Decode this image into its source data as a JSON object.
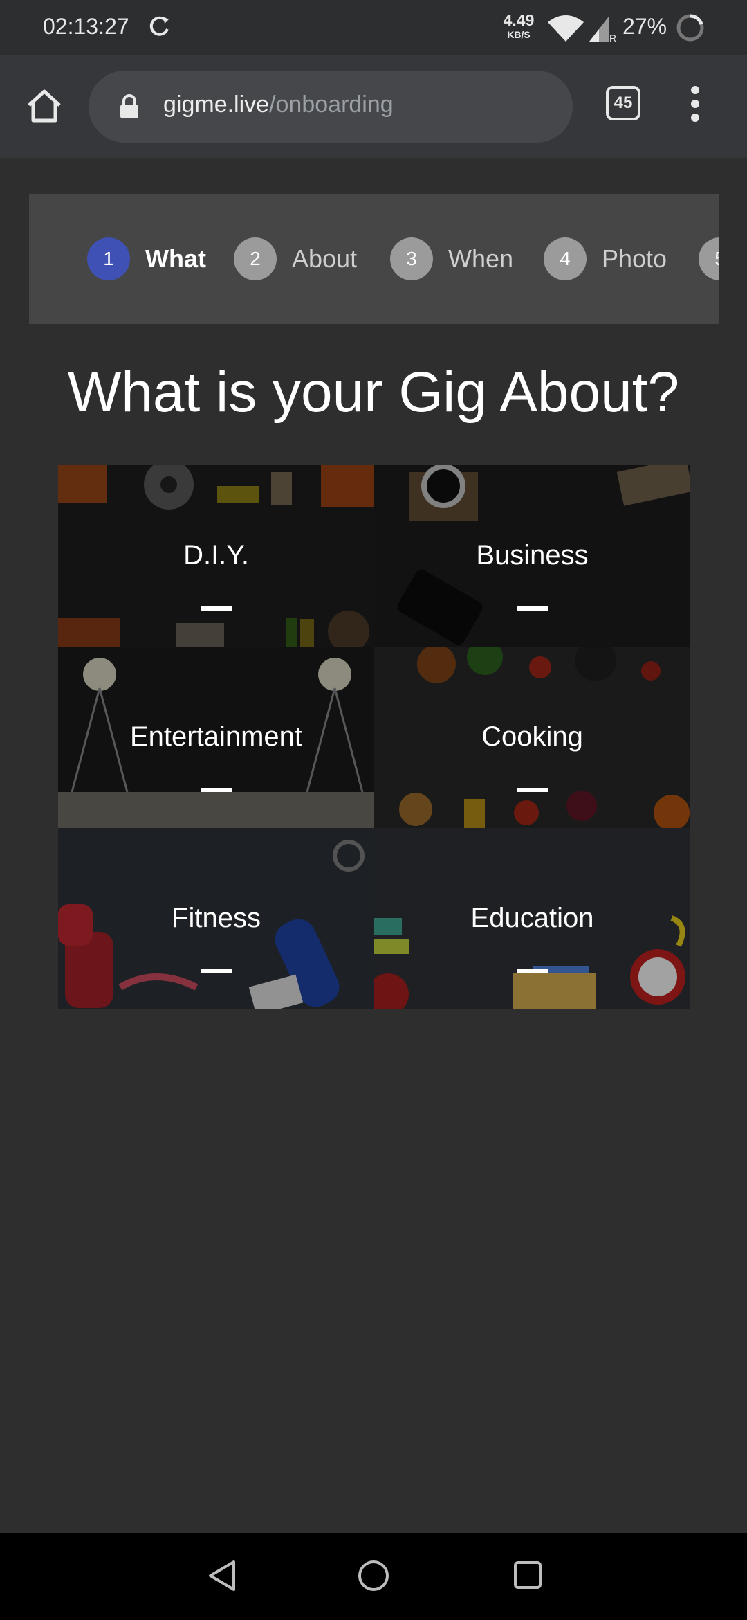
{
  "status_bar": {
    "time": "02:13:27",
    "net_speed": "4.49",
    "net_speed_unit": "KB/S",
    "signal_label": "R",
    "battery": "27%"
  },
  "browser": {
    "url_domain": "gigme.live",
    "url_path": "/onboarding",
    "tab_count": "45"
  },
  "stepper": {
    "steps": [
      {
        "num": "1",
        "label": "What",
        "active": true
      },
      {
        "num": "2",
        "label": "About"
      },
      {
        "num": "3",
        "label": "When"
      },
      {
        "num": "4",
        "label": "Photo"
      },
      {
        "num": "5",
        "label": ""
      }
    ],
    "active_color": "#3f51b5"
  },
  "page": {
    "heading": "What is your Gig About?"
  },
  "categories": [
    {
      "label": "D.I.Y."
    },
    {
      "label": "Business"
    },
    {
      "label": "Entertainment"
    },
    {
      "label": "Cooking"
    },
    {
      "label": "Fitness"
    },
    {
      "label": "Education"
    }
  ]
}
